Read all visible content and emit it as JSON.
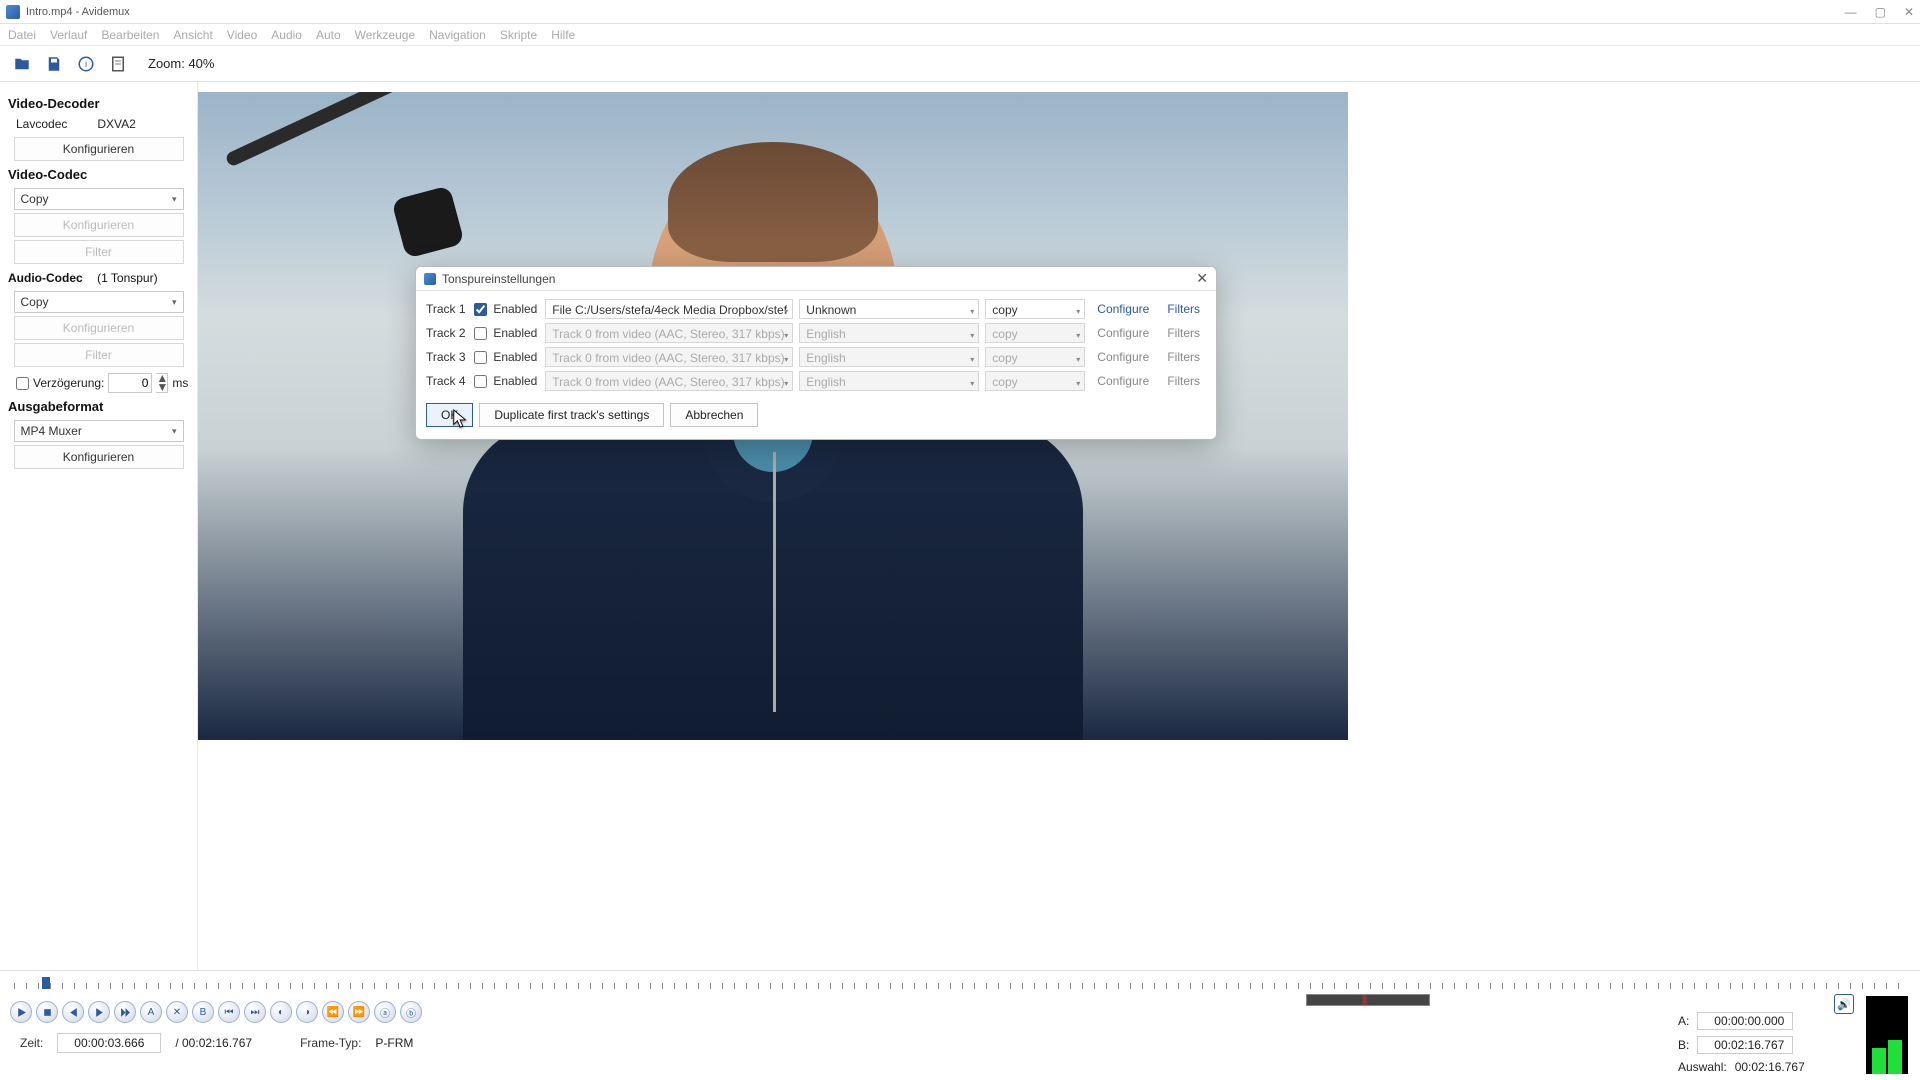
{
  "window": {
    "title": "Intro.mp4 - Avidemux"
  },
  "menu": [
    "Datei",
    "Verlauf",
    "Bearbeiten",
    "Ansicht",
    "Video",
    "Audio",
    "Auto",
    "Werkzeuge",
    "Navigation",
    "Skripte",
    "Hilfe"
  ],
  "toolbar": {
    "zoom": "Zoom: 40%"
  },
  "sidebar": {
    "decoder": {
      "title": "Video-Decoder",
      "lav": "Lavcodec",
      "dxva": "DXVA2",
      "config": "Konfigurieren"
    },
    "vcodec": {
      "title": "Video-Codec",
      "value": "Copy",
      "config": "Konfigurieren",
      "filter": "Filter"
    },
    "acodec": {
      "title": "Audio-Codec",
      "tracks": "(1 Tonspur)",
      "value": "Copy",
      "config": "Konfigurieren",
      "filter": "Filter",
      "delay_label": "Verzögerung:",
      "delay_value": "0",
      "delay_unit": "ms"
    },
    "output": {
      "title": "Ausgabeformat",
      "value": "MP4 Muxer",
      "config": "Konfigurieren"
    }
  },
  "status": {
    "time_label": "Zeit:",
    "time_current": "00:00:03.666",
    "time_total": "/ 00:02:16.767",
    "frame_label": "Frame-Typ:",
    "frame_type": "P-FRM",
    "A_label": "A:",
    "A": "00:00:00.000",
    "B_label": "B:",
    "B": "00:02:16.767",
    "sel_label": "Auswahl:",
    "sel": "00:02:16.767"
  },
  "dialog": {
    "title": "Tonspureinstellungen",
    "enabled_label": "Enabled",
    "tracks": [
      {
        "name": "Track 1",
        "enabled": true,
        "source": "File C:/Users/stefa/4eck Media Dropbox/stef",
        "lang": "Unknown",
        "codec": "copy"
      },
      {
        "name": "Track 2",
        "enabled": false,
        "source": "Track 0 from video (AAC, Stereo, 317 kbps)",
        "lang": "English",
        "codec": "copy"
      },
      {
        "name": "Track 3",
        "enabled": false,
        "source": "Track 0 from video (AAC, Stereo, 317 kbps)",
        "lang": "English",
        "codec": "copy"
      },
      {
        "name": "Track 4",
        "enabled": false,
        "source": "Track 0 from video (AAC, Stereo, 317 kbps)",
        "lang": "English",
        "codec": "copy"
      }
    ],
    "configure": "Configure",
    "filters": "Filters",
    "ok": "OK",
    "duplicate": "Duplicate first track's settings",
    "cancel": "Abbrechen"
  }
}
